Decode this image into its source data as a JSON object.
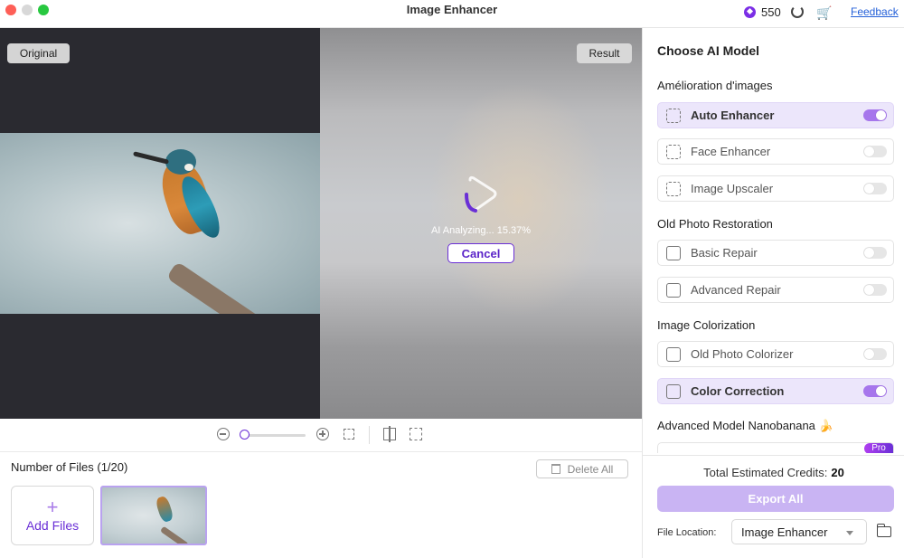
{
  "window": {
    "title": "Image Enhancer"
  },
  "topbar": {
    "credits": "550",
    "feedback": "Feedback"
  },
  "preview": {
    "original_label": "Original",
    "result_label": "Result",
    "status": "AI Analyzing... 15.37%",
    "cancel_label": "Cancel"
  },
  "files": {
    "count_label": "Number of Files (1/20)",
    "delete_all": "Delete All",
    "add_files": "Add Files"
  },
  "panel": {
    "title": "Choose AI Model",
    "sections": [
      {
        "title": "Amélioration d'images",
        "models": [
          {
            "label": "Auto Enhancer",
            "enabled": true
          },
          {
            "label": "Face Enhancer",
            "enabled": false
          },
          {
            "label": "Image Upscaler",
            "enabled": false
          }
        ]
      },
      {
        "title": "Old Photo Restoration",
        "models": [
          {
            "label": "Basic Repair",
            "enabled": false
          },
          {
            "label": "Advanced Repair",
            "enabled": false
          }
        ]
      },
      {
        "title": "Image Colorization",
        "models": [
          {
            "label": "Old Photo Colorizer",
            "enabled": false
          },
          {
            "label": "Color Correction",
            "enabled": true
          }
        ]
      },
      {
        "title": "Advanced Model Nanobanana 🍌",
        "models": []
      }
    ],
    "pro_badge": "Pro",
    "credits_label": "Total Estimated Credits:",
    "credits_value": "20",
    "export_label": "Export All",
    "location_label": "File Location:",
    "location_value": "Image Enhancer"
  },
  "colors": {
    "accent": "#6a2fd6",
    "toggle_on": "#a676ec",
    "active_row": "#ece6fb"
  }
}
